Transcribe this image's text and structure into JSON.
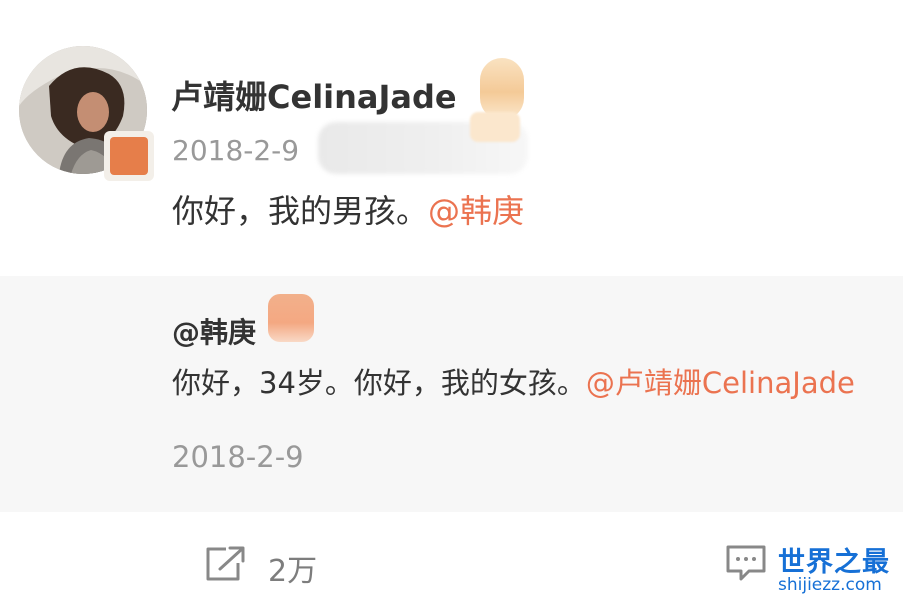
{
  "post": {
    "username": "卢靖姗CelinaJade",
    "timestamp": "2018-2-9",
    "text": "你好，我的男孩。",
    "mention": "@韩庚",
    "avatar_icon": "user-avatar"
  },
  "reply": {
    "author": "@韩庚",
    "text": "你好，34岁。你好，我的女孩。",
    "mention": "@卢靖姗CelinaJade",
    "timestamp": "2018-2-9"
  },
  "actions": {
    "repost_icon": "share-icon",
    "repost_count": "2万",
    "comment_icon": "comment-icon"
  },
  "watermark": {
    "title": "世界之最",
    "url": "shijiezz.com"
  },
  "colors": {
    "accent_link": "#eb7350",
    "text_primary": "#333333",
    "text_secondary": "#999999",
    "reply_background": "#f7f7f7",
    "watermark": "#1670d6"
  }
}
